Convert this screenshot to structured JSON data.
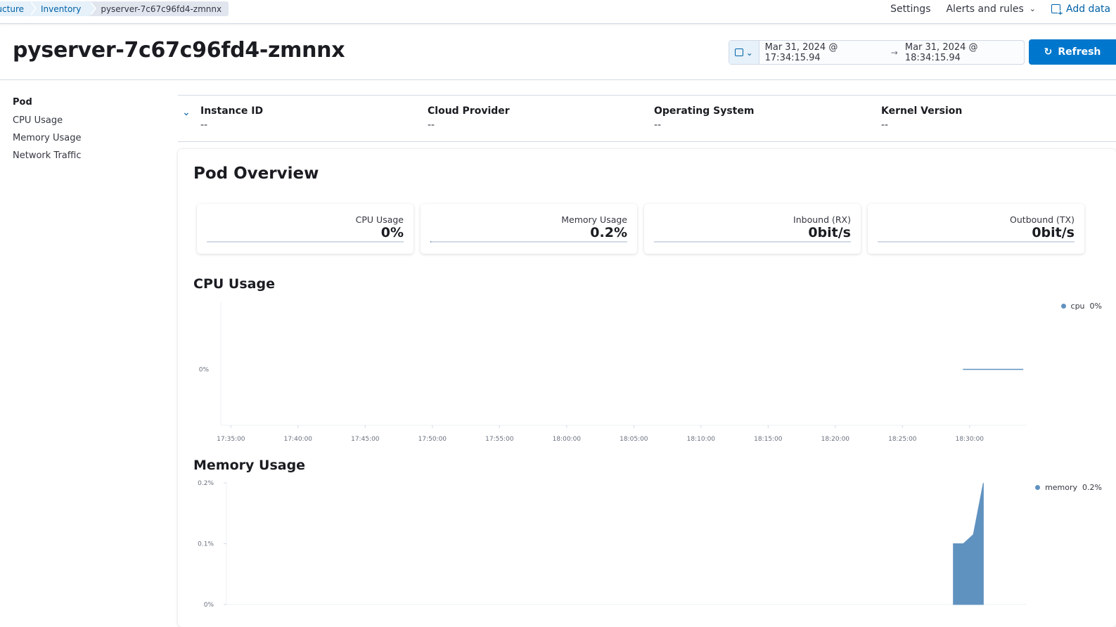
{
  "breadcrumbs": [
    "ructure",
    "Inventory",
    "pyserver-7c67c96fd4-zmnnx"
  ],
  "header_links": {
    "settings": "Settings",
    "alerts": "Alerts and rules",
    "add_data": "Add data"
  },
  "page_title": "pyserver-7c67c96fd4-zmnnx",
  "date_range": {
    "start": "Mar 31, 2024 @ 17:34:15.94",
    "end": "Mar 31, 2024 @ 18:34:15.94"
  },
  "refresh_label": "Refresh",
  "sidenav": {
    "heading": "Pod",
    "items": [
      "CPU Usage",
      "Memory Usage",
      "Network Traffic"
    ]
  },
  "metadata": [
    {
      "key": "Instance ID",
      "value": "--"
    },
    {
      "key": "Cloud Provider",
      "value": "--"
    },
    {
      "key": "Operating System",
      "value": "--"
    },
    {
      "key": "Kernel Version",
      "value": "--"
    }
  ],
  "overview": {
    "title": "Pod Overview",
    "kpis": [
      {
        "label": "CPU Usage",
        "value": "0%",
        "level": 0
      },
      {
        "label": "Memory Usage",
        "value": "0.2%",
        "level": 0.002
      },
      {
        "label": "Inbound (RX)",
        "value": "0bit/s",
        "level": 0
      },
      {
        "label": "Outbound (TX)",
        "value": "0bit/s",
        "level": 0
      }
    ]
  },
  "colors": {
    "accent": "#0077cc",
    "series": "#6092c0",
    "link": "#0061a6"
  },
  "chart_data": [
    {
      "type": "line",
      "title": "CPU Usage",
      "x": [
        "18:29:30",
        "18:30:00",
        "18:31:00",
        "18:32:00",
        "18:33:00",
        "18:34:00"
      ],
      "series": [
        {
          "name": "cpu",
          "values": [
            0,
            0,
            0,
            0,
            0,
            0
          ]
        }
      ],
      "xticks": [
        "17:35:00",
        "17:40:00",
        "17:45:00",
        "17:50:00",
        "17:55:00",
        "18:00:00",
        "18:05:00",
        "18:10:00",
        "18:15:00",
        "18:20:00",
        "18:25:00",
        "18:30:00"
      ],
      "yticks": [
        "0%"
      ],
      "legend": {
        "label": "cpu",
        "value": "0%",
        "placement": "top-right"
      }
    },
    {
      "type": "area",
      "title": "Memory Usage",
      "x": [
        "18:28:45",
        "18:29:30",
        "18:30:15",
        "18:31:00",
        "18:31:00"
      ],
      "series": [
        {
          "name": "memory",
          "values": [
            0.1,
            0.1,
            0.115,
            0.2,
            0
          ]
        }
      ],
      "yticks": [
        "0.2%",
        "0.1%",
        "0%"
      ],
      "ylim": [
        0,
        0.2
      ],
      "legend": {
        "label": "memory",
        "value": "0.2%",
        "placement": "top-right"
      }
    }
  ]
}
